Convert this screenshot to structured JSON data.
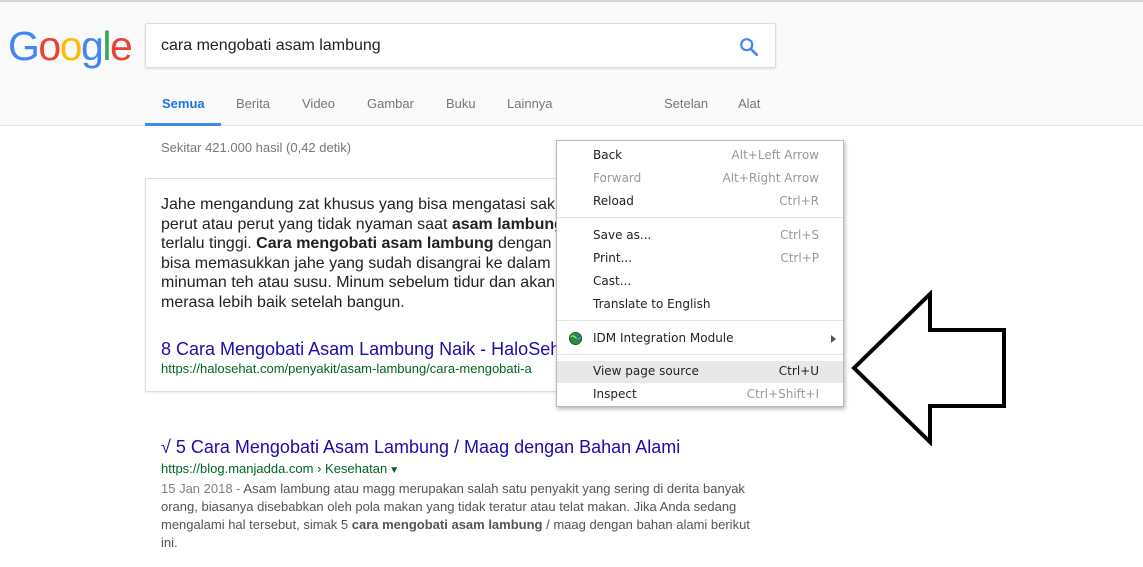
{
  "logo": {
    "letters": [
      {
        "char": "G",
        "color": "#4285F4"
      },
      {
        "char": "o",
        "color": "#EA4335"
      },
      {
        "char": "o",
        "color": "#FBBC05"
      },
      {
        "char": "g",
        "color": "#4285F4"
      },
      {
        "char": "l",
        "color": "#34A853"
      },
      {
        "char": "e",
        "color": "#EA4335"
      }
    ]
  },
  "search": {
    "query": "cara mengobati asam lambung",
    "icon": "search-icon"
  },
  "tabs": {
    "all": "Semua",
    "news": "Berita",
    "videos": "Video",
    "images": "Gambar",
    "books": "Buku",
    "more": "Lainnya",
    "settings": "Setelan",
    "tools": "Alat"
  },
  "stats": "Sekitar 421.000 hasil (0,42 detik)",
  "snippet": {
    "line1": "Jahe mengandung zat khusus yang bisa mengatasi sak",
    "line2a": "perut atau perut yang tidak nyaman saat ",
    "line2b": "asam lambung",
    "line3a": "terlalu tinggi. ",
    "line3b": "Cara mengobati asam lambung",
    "line3c": " dengan",
    "line4": "bisa memasukkan jahe yang sudah disangrai ke dalam",
    "line5": "minuman teh atau susu. Minum sebelum tidur dan akan",
    "line6": "merasa lebih baik setelah bangun.",
    "link": "8 Cara Mengobati Asam Lambung Naik - HaloSeh",
    "url": "https://halosehat.com/penyakit/asam-lambung/cara-mengobati-a"
  },
  "result2": {
    "title": "√ 5 Cara Mengobati Asam Lambung / Maag dengan Bahan Alami",
    "url": "https://blog.manjadda.com › Kesehatan",
    "date": "15 Jan 2018 - ",
    "desc_a": "Asam lambung atau magg merupakan salah satu penyakit yang sering di derita banyak orang, biasanya disebabkan oleh pola makan yang tidak teratur atau telat makan. Jika Anda sedang mengalami hal tersebut, simak 5 ",
    "desc_bold": "cara mengobati asam lambung",
    "desc_b": " / maag dengan bahan alami berikut ini."
  },
  "context_menu": {
    "back": {
      "label": "Back",
      "shortcut": "Alt+Left Arrow"
    },
    "forward": {
      "label": "Forward",
      "shortcut": "Alt+Right Arrow"
    },
    "reload": {
      "label": "Reload",
      "shortcut": "Ctrl+R"
    },
    "save_as": {
      "label": "Save as...",
      "shortcut": "Ctrl+S"
    },
    "print": {
      "label": "Print...",
      "shortcut": "Ctrl+P"
    },
    "cast": {
      "label": "Cast..."
    },
    "translate": {
      "label": "Translate to English"
    },
    "idm": {
      "label": "IDM Integration Module"
    },
    "view_source": {
      "label": "View page source",
      "shortcut": "Ctrl+U"
    },
    "inspect": {
      "label": "Inspect",
      "shortcut": "Ctrl+Shift+I"
    }
  }
}
